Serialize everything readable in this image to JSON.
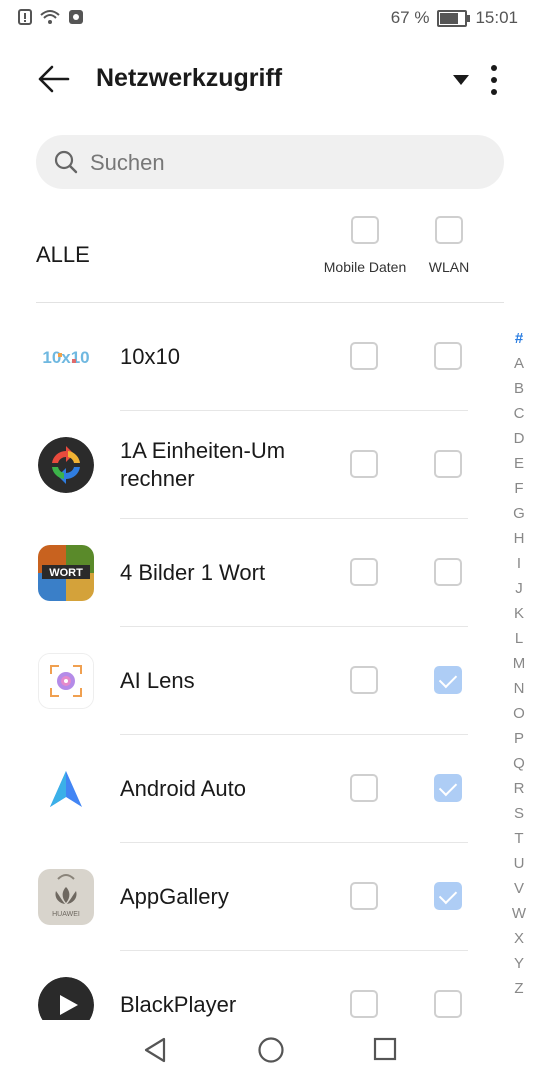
{
  "status": {
    "battery": "67 %",
    "battery_level": 0.67,
    "time": "15:01"
  },
  "title": "Netzwerkzugriff",
  "search": {
    "placeholder": "Suchen"
  },
  "header": {
    "all_label": "ALLE",
    "mobile_label": "Mobile Daten",
    "wlan_label": "WLAN",
    "mobile_checked": false,
    "wlan_checked": false
  },
  "apps": [
    {
      "name": "10x10",
      "icon": "tenxten-icon",
      "mobile": false,
      "wlan": false
    },
    {
      "name": "1A Einheiten-Um rechner",
      "icon": "unit-converter-icon",
      "mobile": false,
      "wlan": false
    },
    {
      "name": "4 Bilder 1 Wort",
      "icon": "four-pics-icon",
      "mobile": false,
      "wlan": false
    },
    {
      "name": "AI Lens",
      "icon": "ai-lens-icon",
      "mobile": false,
      "wlan": true
    },
    {
      "name": "Android Auto",
      "icon": "android-auto-icon",
      "mobile": false,
      "wlan": true
    },
    {
      "name": "AppGallery",
      "icon": "appgallery-icon",
      "mobile": false,
      "wlan": true
    },
    {
      "name": "BlackPlayer",
      "icon": "blackplayer-icon",
      "mobile": false,
      "wlan": false
    }
  ],
  "icon_texts": {
    "tenxten": "10x10",
    "fourpics_word": "WORT",
    "huawei": "HUAWEI"
  },
  "index_letters": [
    "#",
    "A",
    "B",
    "C",
    "D",
    "E",
    "F",
    "G",
    "H",
    "I",
    "J",
    "K",
    "L",
    "M",
    "N",
    "O",
    "P",
    "Q",
    "R",
    "S",
    "T",
    "U",
    "V",
    "W",
    "X",
    "Y",
    "Z"
  ],
  "colors": {
    "accent": "#2a7de1",
    "checked": "#aecdf5"
  }
}
